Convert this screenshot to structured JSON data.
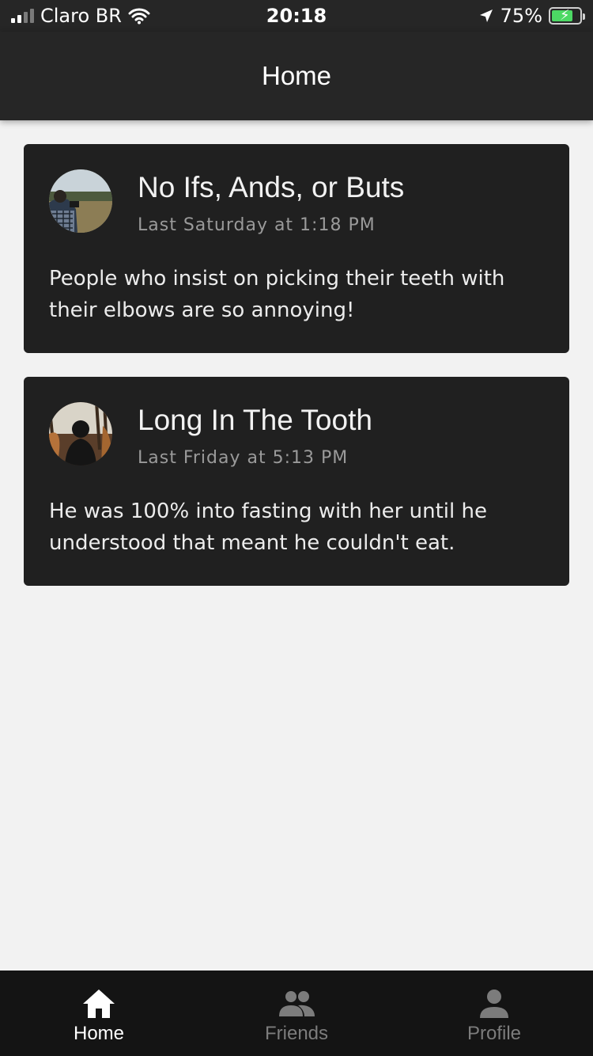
{
  "status_bar": {
    "carrier": "Claro BR",
    "time": "20:18",
    "battery": "75%",
    "battery_level": 0.75
  },
  "header": {
    "title": "Home"
  },
  "posts": [
    {
      "title": "No Ifs, Ands, or Buts",
      "time": "Last Saturday at 1:18 PM",
      "body": "People who insist on picking their teeth with their elbows are so annoying!",
      "avatar_icon": "avatar-photographer"
    },
    {
      "title": "Long In The Tooth",
      "time": "Last Friday at 5:13 PM",
      "body": "He was 100% into fasting with her until he understood that meant he couldn't eat.",
      "avatar_icon": "avatar-silhouette"
    }
  ],
  "tabs": [
    {
      "label": "Home",
      "icon": "home-icon",
      "active": true
    },
    {
      "label": "Friends",
      "icon": "friends-icon",
      "active": false
    },
    {
      "label": "Profile",
      "icon": "profile-icon",
      "active": false
    }
  ],
  "colors": {
    "header_bg": "#262626",
    "card_bg": "#202020",
    "page_bg": "#f2f2f2",
    "tab_bar_bg": "#141414",
    "tab_active": "#ffffff",
    "tab_inactive": "#7c7c7c"
  }
}
